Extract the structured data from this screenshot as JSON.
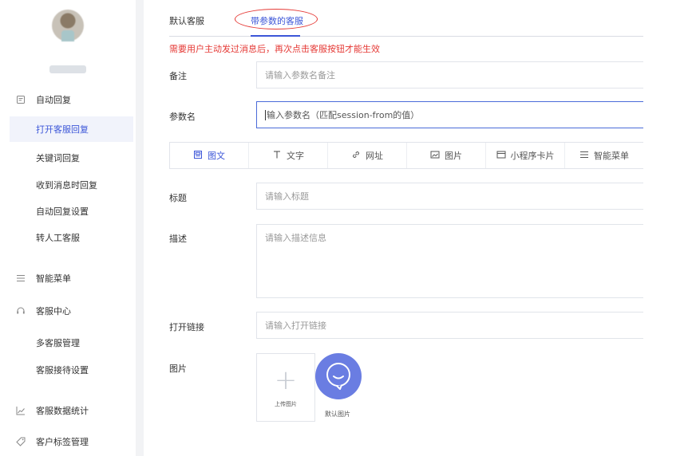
{
  "sidebar": {
    "sections": [
      {
        "label": "自动回复",
        "icon": "message-icon"
      },
      {
        "label": "智能菜单",
        "icon": "menu-list-icon"
      },
      {
        "label": "客服中心",
        "icon": "headset-icon"
      },
      {
        "label": "客服数据统计",
        "icon": "line-chart-icon"
      },
      {
        "label": "客户标签管理",
        "icon": "tag-icon"
      }
    ],
    "auto_reply_items": [
      "打开客服回复",
      "关键词回复",
      "收到消息时回复",
      "自动回复设置",
      "转人工客服"
    ],
    "service_center_items": [
      "多客服管理",
      "客服接待设置"
    ],
    "active_item": "打开客服回复"
  },
  "tabs": [
    {
      "label": "默认客服"
    },
    {
      "label": "带参数的客服"
    }
  ],
  "notice": "需要用户主动发过消息后，再次点击客服按钮才能生效",
  "form": {
    "remark": {
      "label": "备注",
      "placeholder": "请输入参数名备注"
    },
    "param_name": {
      "label": "参数名",
      "placeholder": "输入参数名（匹配session-from的值）"
    },
    "title": {
      "label": "标题",
      "placeholder": "请输入标题"
    },
    "description": {
      "label": "描述",
      "placeholder": "请输入描述信息"
    },
    "open_link": {
      "label": "打开链接",
      "placeholder": "请输入打开链接"
    },
    "image": {
      "label": "图片",
      "upload_caption": "上传图片",
      "default_caption": "默认图片"
    }
  },
  "content_types": [
    {
      "label": "图文",
      "icon": "image-text-icon"
    },
    {
      "label": "文字",
      "icon": "text-icon"
    },
    {
      "label": "网址",
      "icon": "link-icon"
    },
    {
      "label": "图片",
      "icon": "picture-icon"
    },
    {
      "label": "小程序卡片",
      "icon": "mini-program-card-icon"
    },
    {
      "label": "智能菜单",
      "icon": "menu-list-icon"
    }
  ],
  "colors": {
    "accent": "#3c56d8",
    "warning": "#e53935",
    "default_image": "#6a7de2"
  }
}
